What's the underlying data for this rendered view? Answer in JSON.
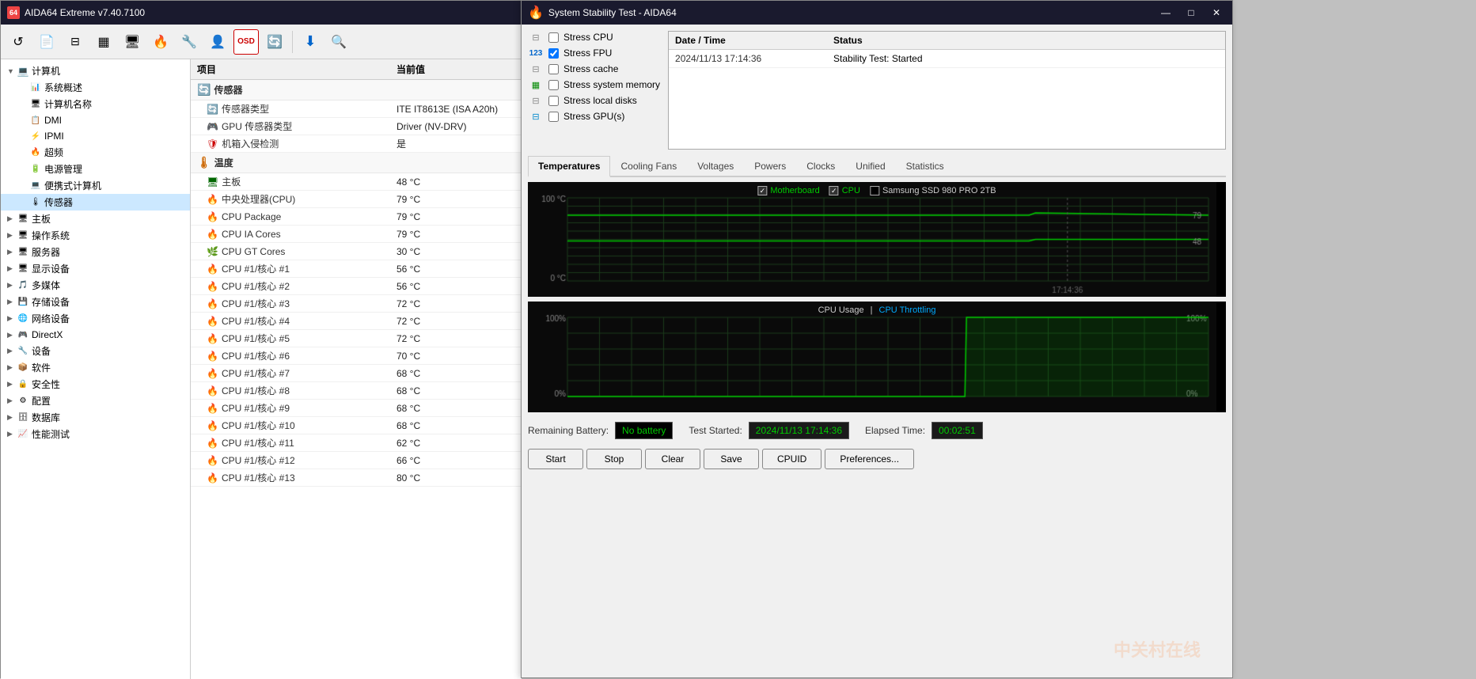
{
  "mainWindow": {
    "title": "AIDA64 Extreme v7.40.7100",
    "appBadge": "64"
  },
  "toolbar": {
    "buttons": [
      "↺",
      "📄",
      "—",
      "▦",
      "🖥",
      "🔥",
      "🔧",
      "👤",
      "OSD",
      "🔄",
      "|",
      "⬇",
      "🔍"
    ]
  },
  "sidebar": {
    "items": [
      {
        "level": 0,
        "arrow": "▼",
        "icon": "💻",
        "label": "计算机",
        "selected": false
      },
      {
        "level": 1,
        "arrow": "",
        "icon": "📊",
        "label": "系统概述",
        "selected": false
      },
      {
        "level": 1,
        "arrow": "",
        "icon": "🖥",
        "label": "计算机名称",
        "selected": false
      },
      {
        "level": 1,
        "arrow": "",
        "icon": "📋",
        "label": "DMI",
        "selected": false
      },
      {
        "level": 1,
        "arrow": "",
        "icon": "⚡",
        "label": "IPMI",
        "selected": false
      },
      {
        "level": 1,
        "arrow": "",
        "icon": "🔥",
        "label": "超频",
        "selected": false
      },
      {
        "level": 1,
        "arrow": "",
        "icon": "🔋",
        "label": "电源管理",
        "selected": false
      },
      {
        "level": 1,
        "arrow": "",
        "icon": "💾",
        "label": "便携式计算机",
        "selected": false
      },
      {
        "level": 1,
        "arrow": "▼",
        "icon": "🌡",
        "label": "传感器",
        "selected": true
      },
      {
        "level": 0,
        "arrow": "▶",
        "icon": "🖥",
        "label": "主板",
        "selected": false
      },
      {
        "level": 0,
        "arrow": "▶",
        "icon": "🖥",
        "label": "操作系统",
        "selected": false
      },
      {
        "level": 0,
        "arrow": "▶",
        "icon": "🖥",
        "label": "服务器",
        "selected": false
      },
      {
        "level": 0,
        "arrow": "▶",
        "icon": "🖥",
        "label": "显示设备",
        "selected": false
      },
      {
        "level": 0,
        "arrow": "▶",
        "icon": "🎵",
        "label": "多媒体",
        "selected": false
      },
      {
        "level": 0,
        "arrow": "▶",
        "icon": "💾",
        "label": "存储设备",
        "selected": false
      },
      {
        "level": 0,
        "arrow": "▶",
        "icon": "🌐",
        "label": "网络设备",
        "selected": false
      },
      {
        "level": 0,
        "arrow": "▶",
        "icon": "🎮",
        "label": "DirectX",
        "selected": false
      },
      {
        "level": 0,
        "arrow": "▶",
        "icon": "🔧",
        "label": "设备",
        "selected": false
      },
      {
        "level": 0,
        "arrow": "▶",
        "icon": "📦",
        "label": "软件",
        "selected": false
      },
      {
        "level": 0,
        "arrow": "▶",
        "icon": "🔒",
        "label": "安全性",
        "selected": false
      },
      {
        "level": 0,
        "arrow": "▶",
        "icon": "⚙",
        "label": "配置",
        "selected": false
      },
      {
        "level": 0,
        "arrow": "▶",
        "icon": "🗄",
        "label": "数据库",
        "selected": false
      },
      {
        "level": 0,
        "arrow": "▶",
        "icon": "📈",
        "label": "性能测试",
        "selected": false
      }
    ]
  },
  "tableHeader": {
    "col1": "项目",
    "col2": "当前值"
  },
  "tableData": {
    "sensorSection": "传感器",
    "sensorRows": [
      {
        "indent": true,
        "name": "传感器类型",
        "icon": "🔄",
        "value": ""
      },
      {
        "indent": true,
        "name": "传感器类型",
        "icon": "📋",
        "value": "ITE IT8613E (ISA A20h)"
      },
      {
        "indent": true,
        "name": "GPU 传感器类型",
        "icon": "🎮",
        "value": "Driver  (NV-DRV)"
      },
      {
        "indent": true,
        "name": "机箱入侵检测",
        "icon": "🛡",
        "value": "是"
      }
    ],
    "tempSection": "温度",
    "tempRows": [
      {
        "name": "主板",
        "icon": "🖥",
        "value": "48 °C"
      },
      {
        "name": "中央处理器(CPU)",
        "icon": "🔥",
        "value": "79 °C"
      },
      {
        "name": "CPU Package",
        "icon": "🔥",
        "value": "79 °C"
      },
      {
        "name": "CPU IA Cores",
        "icon": "🔥",
        "value": "79 °C"
      },
      {
        "name": "CPU GT Cores",
        "icon": "🌿",
        "value": "30 °C"
      },
      {
        "name": "CPU #1/核心 #1",
        "icon": "🔥",
        "value": "56 °C"
      },
      {
        "name": "CPU #1/核心 #2",
        "icon": "🔥",
        "value": "56 °C"
      },
      {
        "name": "CPU #1/核心 #3",
        "icon": "🔥",
        "value": "72 °C"
      },
      {
        "name": "CPU #1/核心 #4",
        "icon": "🔥",
        "value": "72 °C"
      },
      {
        "name": "CPU #1/核心 #5",
        "icon": "🔥",
        "value": "72 °C"
      },
      {
        "name": "CPU #1/核心 #6",
        "icon": "🔥",
        "value": "70 °C"
      },
      {
        "name": "CPU #1/核心 #7",
        "icon": "🔥",
        "value": "68 °C"
      },
      {
        "name": "CPU #1/核心 #8",
        "icon": "🔥",
        "value": "68 °C"
      },
      {
        "name": "CPU #1/核心 #9",
        "icon": "🔥",
        "value": "68 °C"
      },
      {
        "name": "CPU #1/核心 #10",
        "icon": "🔥",
        "value": "68 °C"
      },
      {
        "name": "CPU #1/核心 #11",
        "icon": "🔥",
        "value": "62 °C"
      },
      {
        "name": "CPU #1/核心 #12",
        "icon": "🔥",
        "value": "66 °C"
      },
      {
        "name": "CPU #1/核心 #13",
        "icon": "🔥",
        "value": "80 °C"
      }
    ]
  },
  "stabilityWindow": {
    "title": "System Stability Test - AIDA64",
    "stressItems": [
      {
        "id": "stress_cpu",
        "label": "Stress CPU",
        "checked": false,
        "iconColor": "#888"
      },
      {
        "id": "stress_fpu",
        "label": "Stress FPU",
        "checked": true,
        "iconColor": "#0066cc"
      },
      {
        "id": "stress_cache",
        "label": "Stress cache",
        "checked": false,
        "iconColor": "#888"
      },
      {
        "id": "stress_memory",
        "label": "Stress system memory",
        "checked": false,
        "iconColor": "#008800"
      },
      {
        "id": "stress_disks",
        "label": "Stress local disks",
        "checked": false,
        "iconColor": "#888"
      },
      {
        "id": "stress_gpu",
        "label": "Stress GPU(s)",
        "checked": false,
        "iconColor": "#0088cc"
      }
    ],
    "statusTable": {
      "headers": [
        "Date / Time",
        "Status"
      ],
      "rows": [
        {
          "datetime": "2024/11/13 17:14:36",
          "status": "Stability Test: Started"
        }
      ]
    },
    "tabs": [
      "Temperatures",
      "Cooling Fans",
      "Voltages",
      "Powers",
      "Clocks",
      "Unified",
      "Statistics"
    ],
    "activeTab": "Temperatures",
    "chart1": {
      "legend": [
        {
          "label": "Motherboard",
          "checked": true,
          "color": "#00cc00"
        },
        {
          "label": "CPU",
          "checked": true,
          "color": "#00cc00"
        },
        {
          "label": "Samsung SSD 980 PRO 2TB",
          "checked": false,
          "color": "#ffffff"
        }
      ],
      "yMax": "100",
      "yMin": "0",
      "yUnit": "°C",
      "yMaxLabel": "100 °C",
      "yMinLabel": "0 °C",
      "value1": "79",
      "value2": "48",
      "timestamp": "17:14:36"
    },
    "chart2": {
      "title1": "CPU Usage",
      "title2": "CPU Throttling",
      "yMaxLabel": "100%",
      "yMinLabel": "0%",
      "rightValue": "100%",
      "rightValueBottom": "0%"
    },
    "bottomBar": {
      "remainingBatteryLabel": "Remaining Battery:",
      "remainingBatteryValue": "No battery",
      "testStartedLabel": "Test Started:",
      "testStartedValue": "2024/11/13 17:14:36",
      "elapsedTimeLabel": "Elapsed Time:",
      "elapsedTimeValue": "00:02:51"
    },
    "buttons": {
      "start": "Start",
      "stop": "Stop",
      "clear": "Clear",
      "save": "Save",
      "cpuid": "CPUID",
      "preferences": "Preferences..."
    }
  },
  "watermark": "中关村在线"
}
